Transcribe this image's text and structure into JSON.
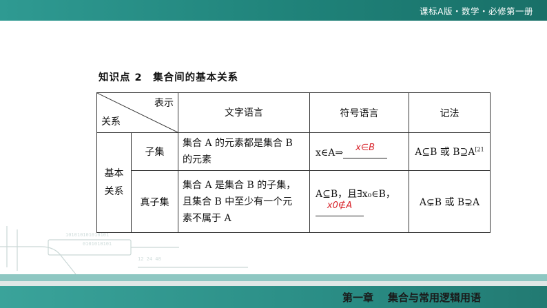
{
  "header": {
    "series": "课标A版・数学・必修第一册"
  },
  "section_title": "知识点 2　集合间的基本关系",
  "table": {
    "diag_top": "表示",
    "diag_bottom": "关系",
    "col_text": "文字语言",
    "col_symbol": "符号语言",
    "col_note": "记法",
    "group_label_1": "基本",
    "group_label_2": "关系",
    "rows": [
      {
        "type": "子集",
        "desc_1": "集合 A 的元素都是集合 B",
        "desc_2": "的元素",
        "sym_prefix": "x∈A⇒",
        "sym_fill": "x∈B",
        "note": "A⊆B 或 B⊇A",
        "note_sup": "[21"
      },
      {
        "type": "真子集",
        "desc_1": "集合 A 是集合 B 的子集，",
        "desc_2": "且集合 B 中至少有一个元",
        "desc_3": "素不属于 A",
        "sym_1": "A⊆B，且∃x₀∈B，",
        "sym_fill": "x0∉A",
        "note": "A⊊B 或 B⊋A"
      }
    ]
  },
  "footer": {
    "chapter": "第一章",
    "chapter_title": "集合与常用逻辑用语"
  }
}
